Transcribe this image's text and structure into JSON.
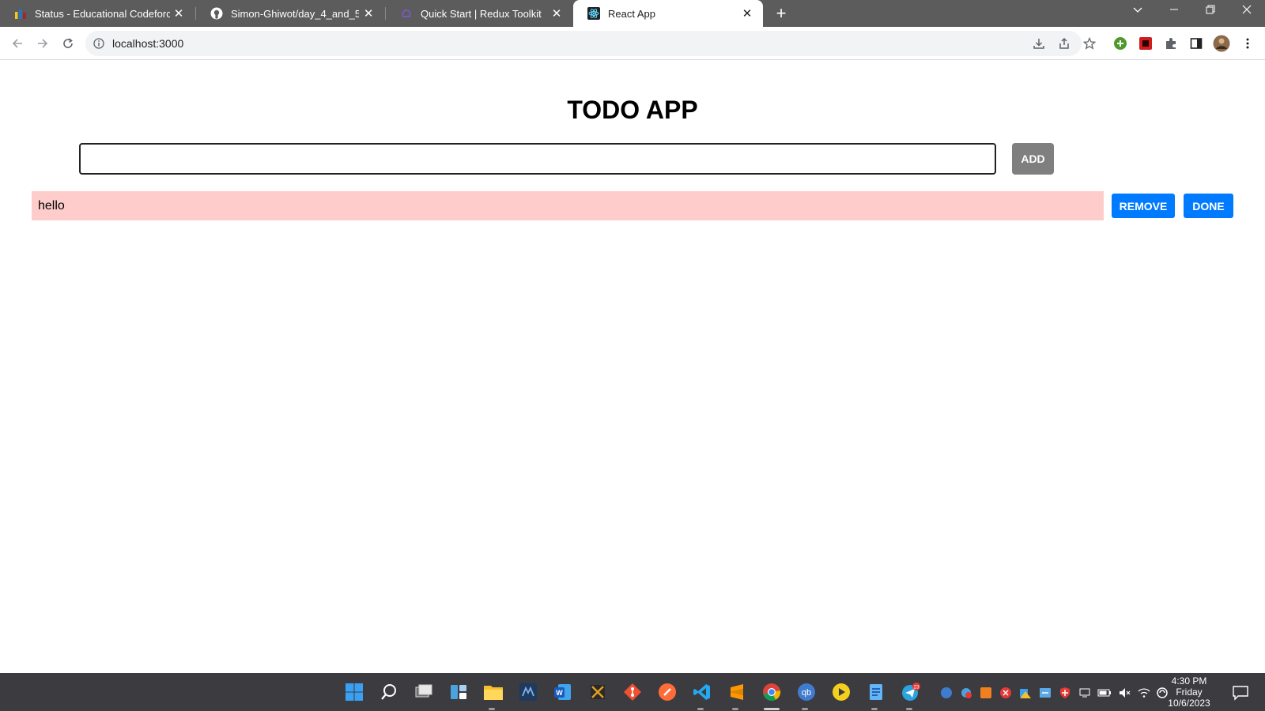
{
  "browser": {
    "tabs": [
      {
        "title": "Status - Educational Codeforces",
        "favicon": "codeforces-icon",
        "active": false
      },
      {
        "title": "Simon-Ghiwot/day_4_and_5",
        "favicon": "github-icon",
        "active": false
      },
      {
        "title": "Quick Start | Redux Toolkit",
        "favicon": "redux-icon",
        "active": false
      },
      {
        "title": "React App",
        "favicon": "react-icon",
        "active": true
      }
    ],
    "new_tab_label": "+",
    "close_glyph": "✕",
    "url": "localhost:3000"
  },
  "app": {
    "title": "TODO APP",
    "input_value": "",
    "input_placeholder": "",
    "add_label": "ADD",
    "todos": [
      {
        "text": "hello",
        "remove_label": "REMOVE",
        "done_label": "DONE"
      }
    ]
  },
  "taskbar": {
    "time": "4:30 PM",
    "day": "Friday",
    "date": "10/6/2023",
    "telegram_badge": "23"
  },
  "colors": {
    "todo_row_bg": "#ffcccc",
    "primary_button": "#007bff",
    "add_button": "#7f7f7f",
    "tabstrip_bg": "#5c5c5c",
    "taskbar_bg": "#3b3b40"
  }
}
